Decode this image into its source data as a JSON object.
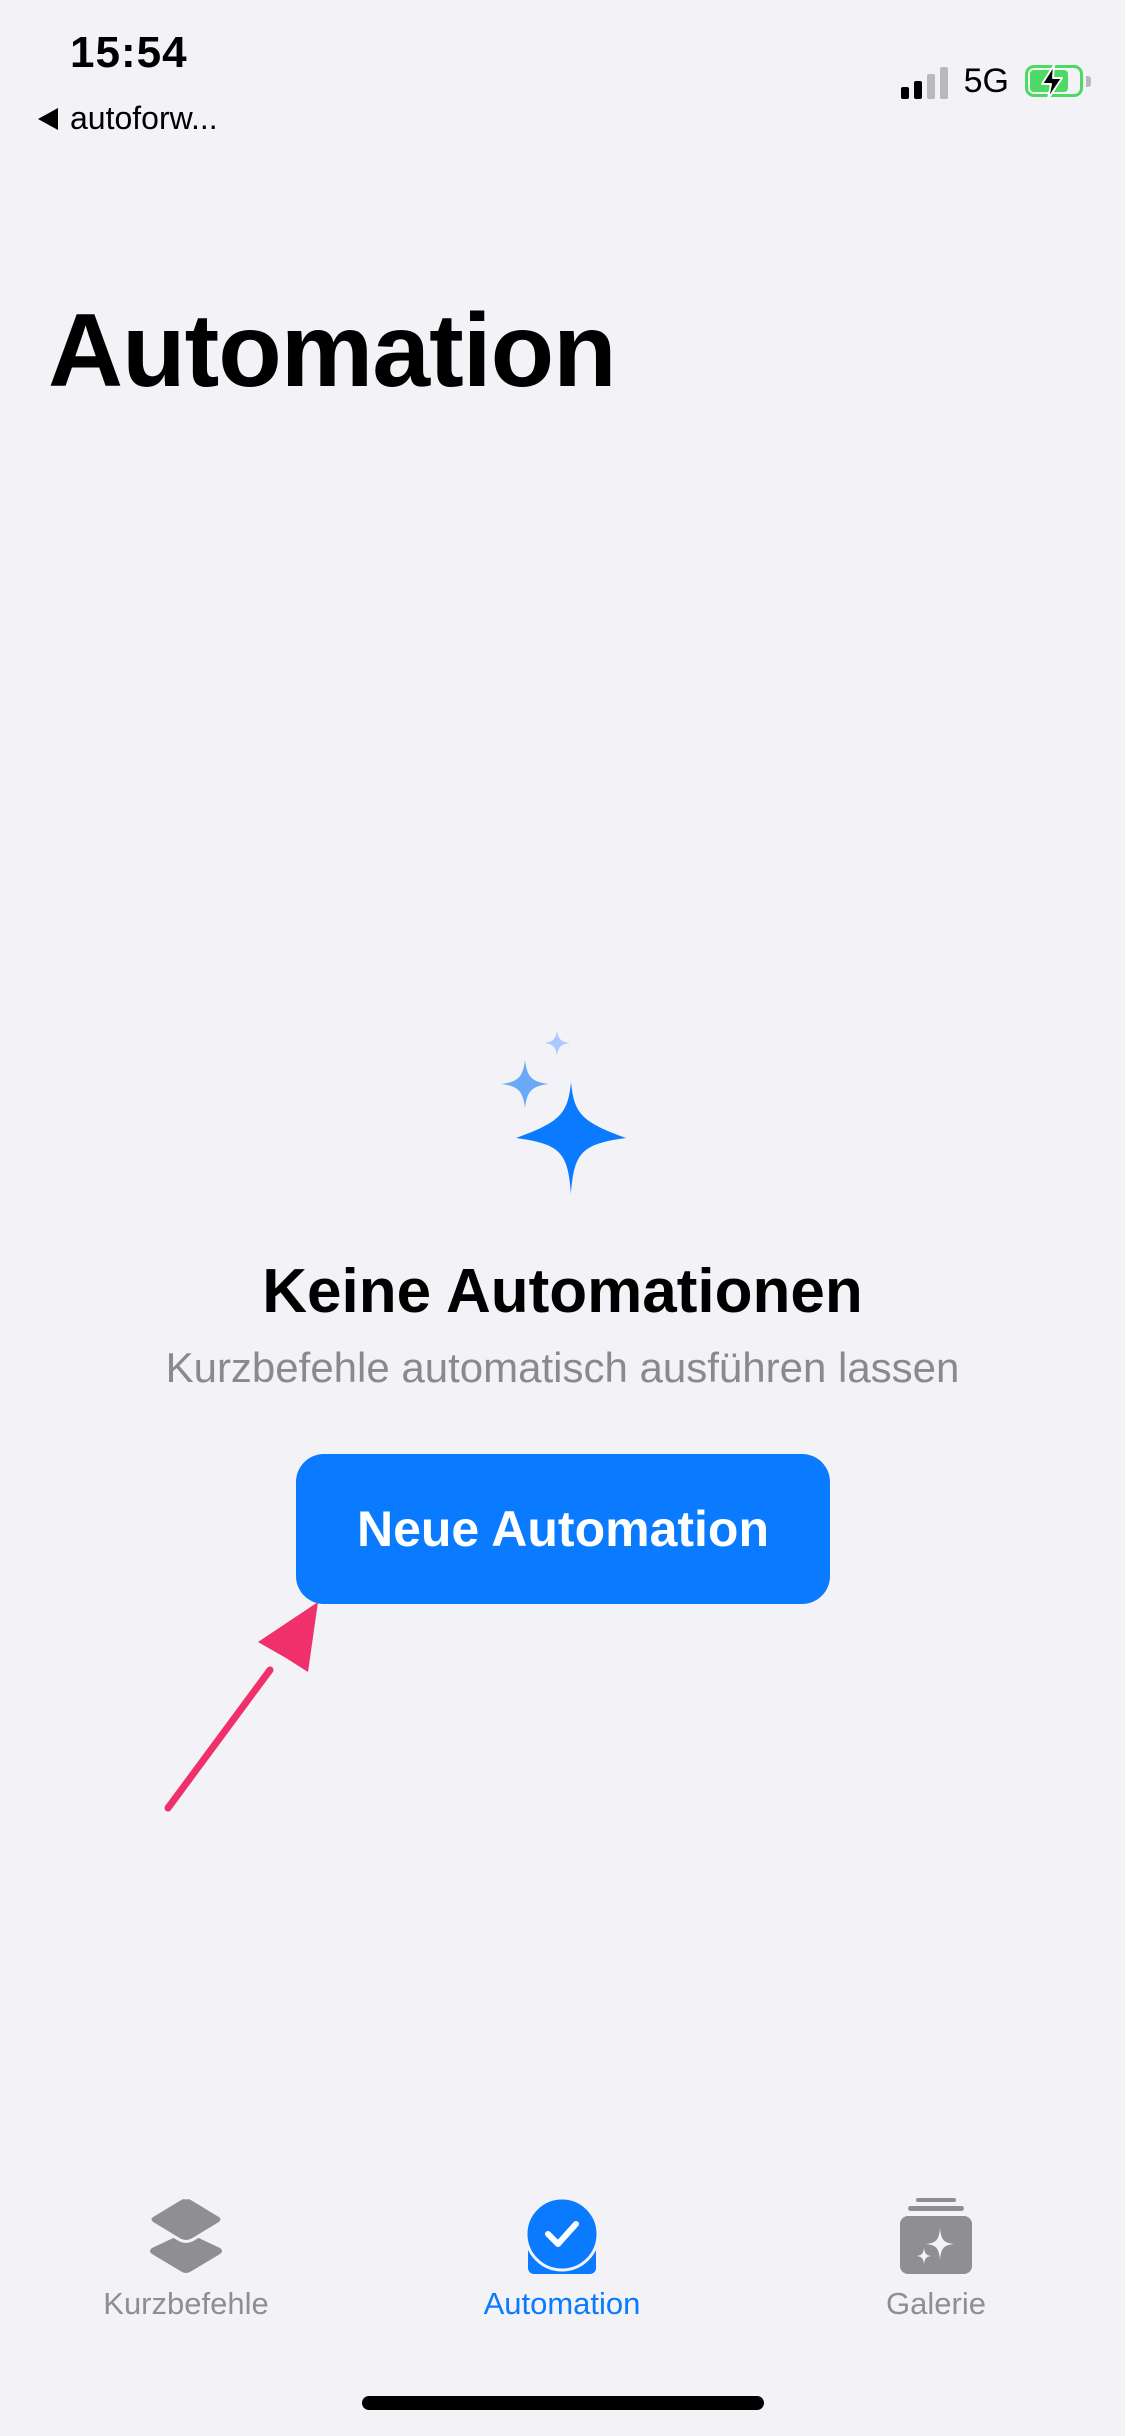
{
  "status_bar": {
    "time": "15:54",
    "back_app": "autoforw...",
    "network": "5G",
    "signal_bars_active": 2,
    "battery": "charging"
  },
  "page": {
    "title": "Automation"
  },
  "empty_state": {
    "icon": "sparkles-icon",
    "title": "Keine Automationen",
    "subtitle": "Kurzbefehle automatisch ausführen lassen",
    "button_label": "Neue Automation"
  },
  "tab_bar": {
    "tabs": [
      {
        "label": "Kurzbefehle",
        "icon": "layers-icon",
        "active": false
      },
      {
        "label": "Automation",
        "icon": "automation-check-icon",
        "active": true
      },
      {
        "label": "Galerie",
        "icon": "gallery-sparkle-icon",
        "active": false
      }
    ]
  },
  "colors": {
    "accent": "#0a7aff",
    "background": "#f2f2f7",
    "annotation_arrow": "#f0306b",
    "inactive_tab": "#8e8e93",
    "battery": "#4cd964"
  }
}
